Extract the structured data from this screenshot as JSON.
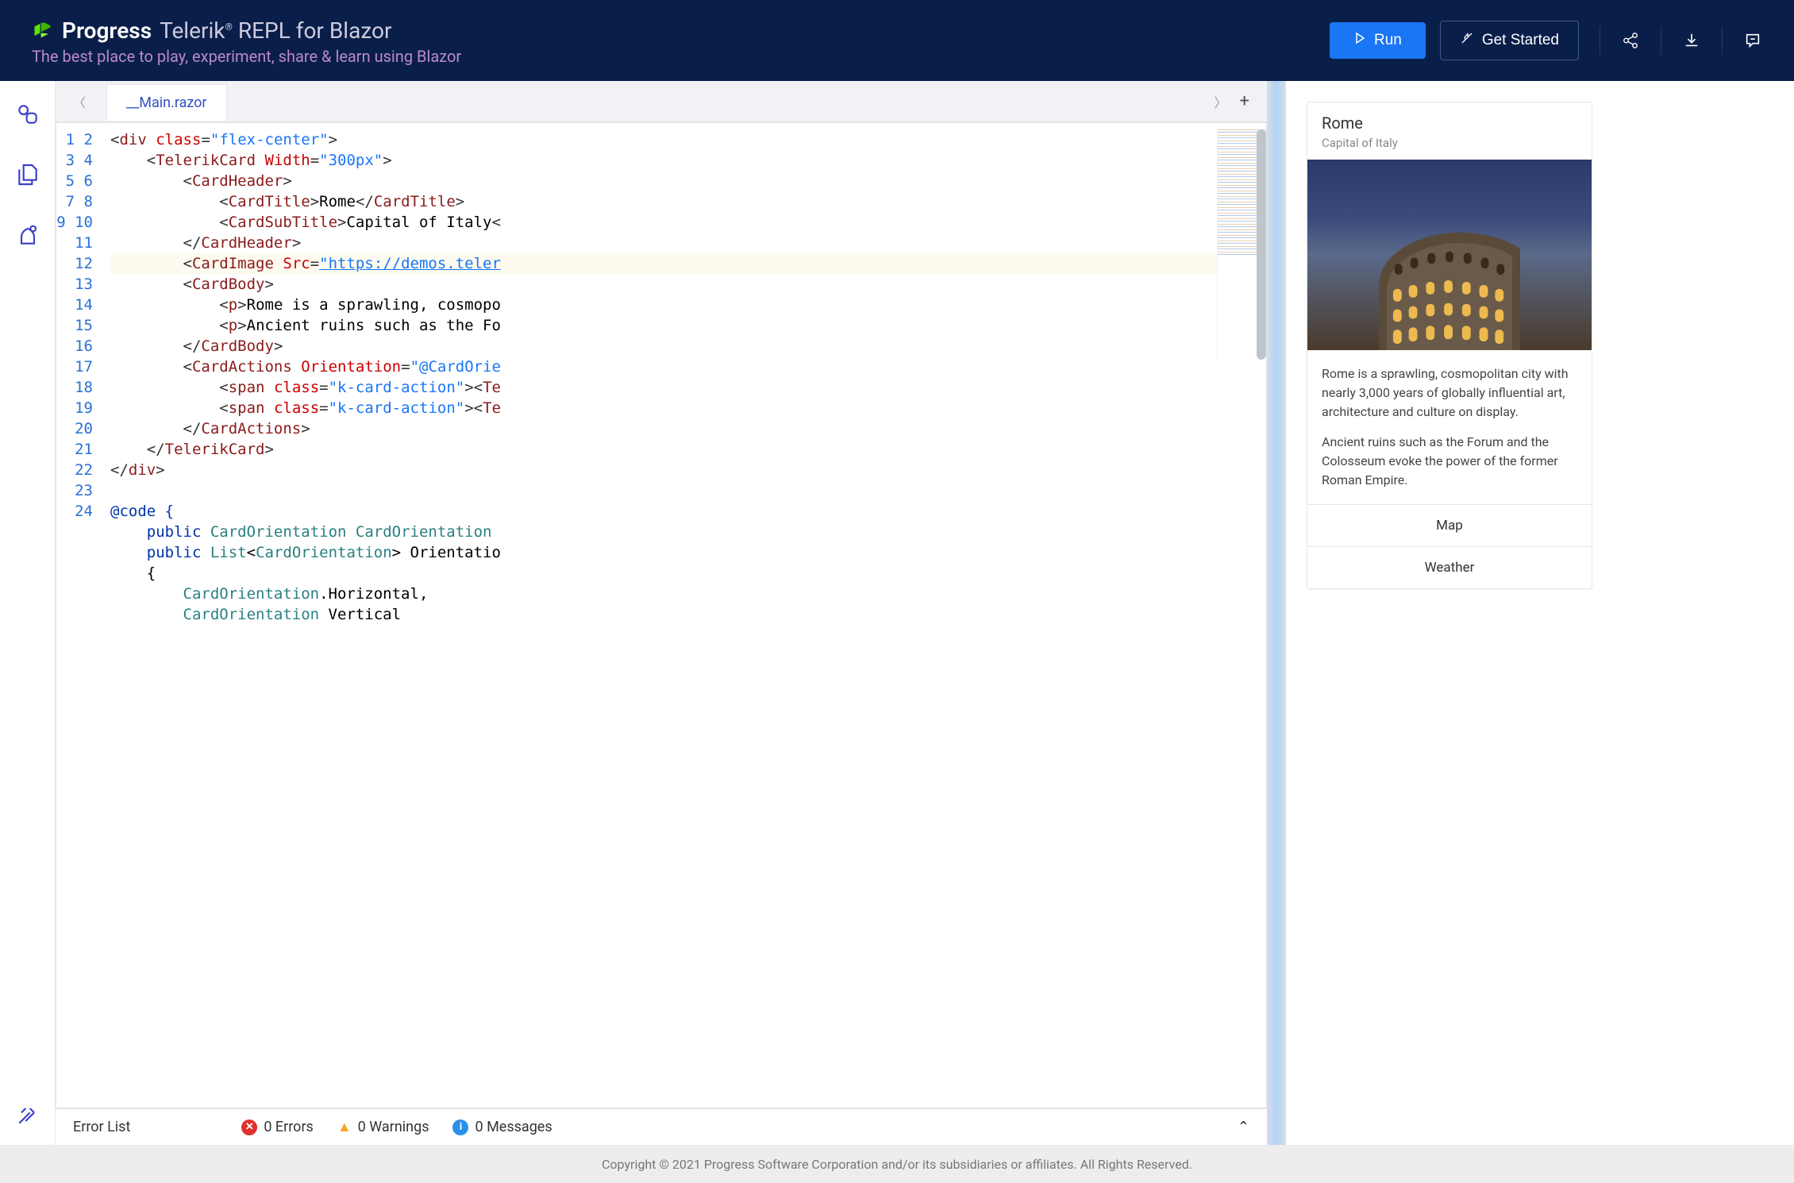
{
  "header": {
    "brand_main": "Progress",
    "brand_sub1": "Telerik",
    "brand_sub2": "REPL for Blazor",
    "tagline": "The best place to play, experiment, share & learn using Blazor",
    "run_label": "Run",
    "get_started_label": "Get Started"
  },
  "tabs": {
    "active": "__Main.razor"
  },
  "gutter": [
    "1",
    "2",
    "3",
    "4",
    "5",
    "6",
    "7",
    "8",
    "9",
    "10",
    "11",
    "12",
    "13",
    "14",
    "15",
    "16",
    "17",
    "18",
    "19",
    "20",
    "21",
    "22",
    "23",
    "24"
  ],
  "code": [
    "<div class=\"flex-center\">",
    "    <TelerikCard Width=\"300px\">",
    "        <CardHeader>",
    "            <CardTitle>Rome</CardTitle>",
    "            <CardSubTitle>Capital of Italy<",
    "        </CardHeader>",
    "        <CardImage Src=\"https://demos.teler",
    "        <CardBody>",
    "            <p>Rome is a sprawling, cosmopo",
    "            <p>Ancient ruins such as the Fo",
    "        </CardBody>",
    "        <CardActions Orientation=\"@CardOrie",
    "            <span class=\"k-card-action\"><Te",
    "            <span class=\"k-card-action\"><Te",
    "        </CardActions>",
    "    </TelerikCard>",
    "</div>",
    "",
    "@code {",
    "    public CardOrientation CardOrientation",
    "    public List<CardOrientation> Orientatio",
    "    {",
    "        CardOrientation.Horizontal,",
    "        CardOrientation Vertical"
  ],
  "error_bar": {
    "title": "Error List",
    "errors": "0 Errors",
    "warnings": "0 Warnings",
    "messages": "0 Messages"
  },
  "preview": {
    "title": "Rome",
    "subtitle": "Capital of Italy",
    "p1": "Rome is a sprawling, cosmopolitan city with nearly 3,000 years of globally influential art, architecture and culture on display.",
    "p2": "Ancient ruins such as the Forum and the Colosseum evoke the power of the former Roman Empire.",
    "action1": "Map",
    "action2": "Weather"
  },
  "footer": "Copyright © 2021 Progress Software Corporation and/or its subsidiaries or affiliates. All Rights Reserved."
}
